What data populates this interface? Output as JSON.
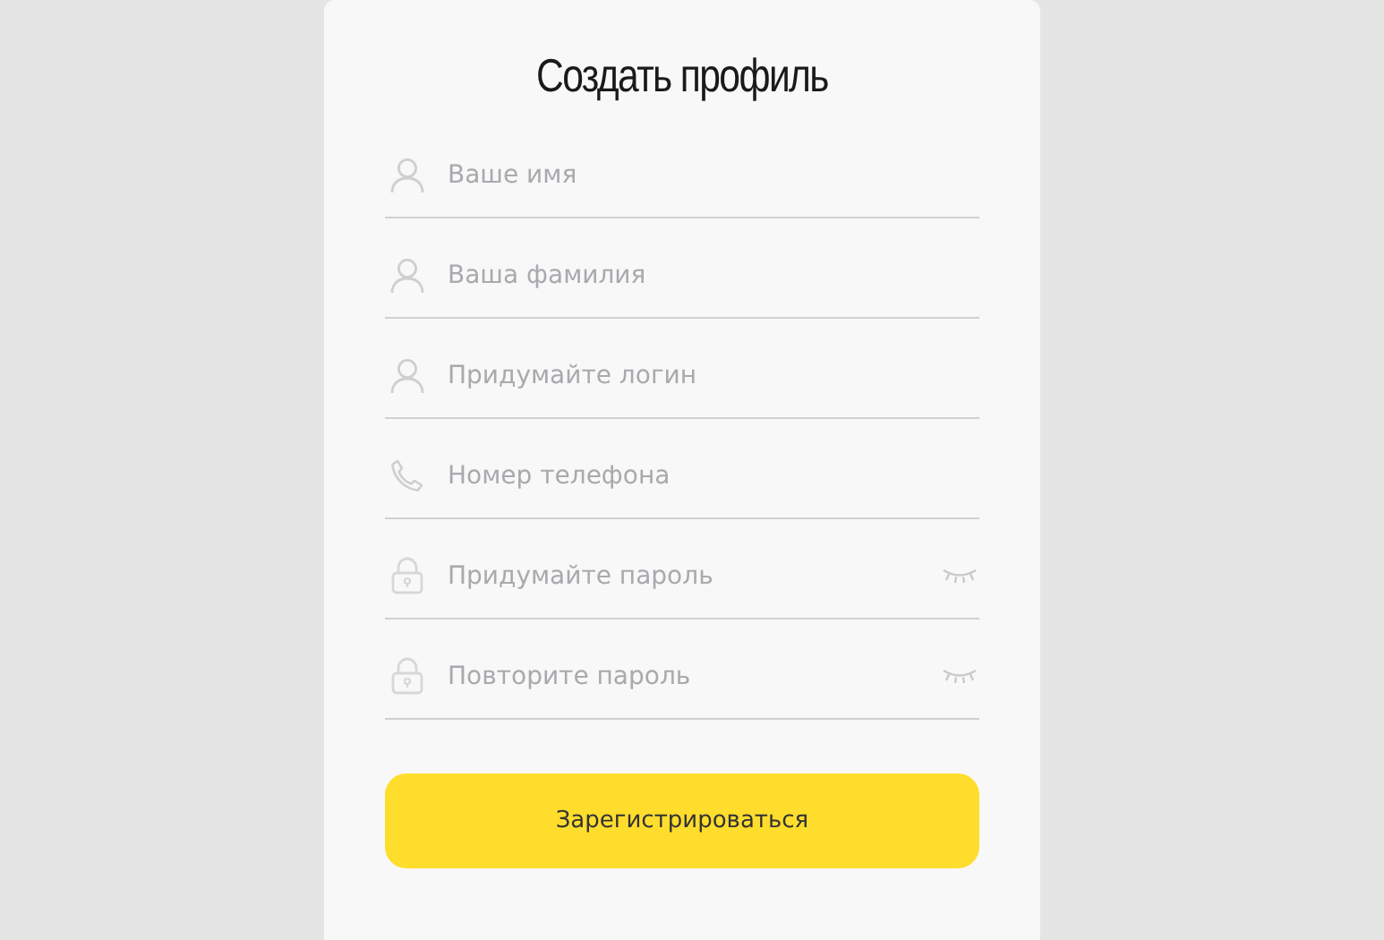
{
  "title": "Создать профиль",
  "fields": [
    {
      "kind": "person",
      "placeholder": "Ваше имя"
    },
    {
      "kind": "person",
      "placeholder": "Ваша фамилия"
    },
    {
      "kind": "person",
      "placeholder": "Придумайте логин"
    },
    {
      "kind": "phone",
      "placeholder": "Номер телефона"
    },
    {
      "kind": "password",
      "placeholder": "Придумайте пароль"
    },
    {
      "kind": "password",
      "placeholder": "Повторите пароль"
    }
  ],
  "submit": "Зарегистрироваться"
}
